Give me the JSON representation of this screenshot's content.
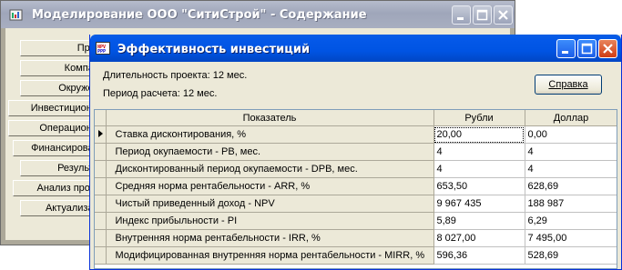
{
  "back_window": {
    "title": "Моделирование ООО \"СитиСтрой\" - Содержание",
    "sidebar": [
      "Проект",
      "Компания",
      "Окружение",
      "Инвестиционный",
      "Операционный",
      "Финансирование",
      "Результаты",
      "Анализ проекта",
      "Актуализация"
    ]
  },
  "front_window": {
    "title": "Эффективность инвестиций",
    "project_duration": "Длительность проекта: 12 мес.",
    "calc_period": "Период расчета: 12 мес.",
    "help_label": "Справка",
    "table": {
      "headers": [
        "Показатель",
        "Рубли",
        "Доллар"
      ],
      "rows": [
        {
          "name": "Ставка дисконтирования, %",
          "rub": "20,00",
          "usd": "0,00"
        },
        {
          "name": "Период окупаемости - PB, мес.",
          "rub": "4",
          "usd": "4"
        },
        {
          "name": "Дисконтированный период окупаемости - DPB, мес.",
          "rub": "4",
          "usd": "4"
        },
        {
          "name": "Средняя норма рентабельности - ARR, %",
          "rub": "653,50",
          "usd": "628,69"
        },
        {
          "name": "Чистый приведенный доход - NPV",
          "rub": "9 967 435",
          "usd": "188 987"
        },
        {
          "name": "Индекс прибыльности - PI",
          "rub": "5,89",
          "usd": "6,29"
        },
        {
          "name": "Внутренняя норма рентабельности - IRR, %",
          "rub": "8 027,00",
          "usd": "7 495,00"
        },
        {
          "name": "Модифицированная внутренняя норма рентабельности - MIRR, %",
          "rub": "596,36",
          "usd": "528,69"
        }
      ]
    }
  }
}
